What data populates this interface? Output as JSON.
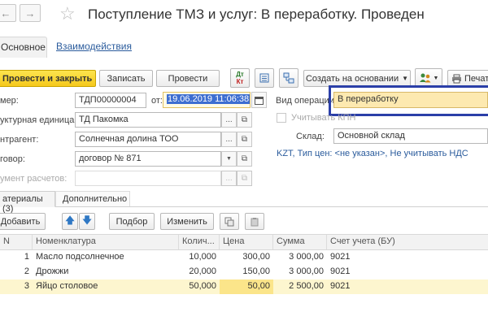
{
  "header": {
    "title": "Поступление ТМЗ и услуг: В переработку. Проведен"
  },
  "tabs": {
    "main": "Основное",
    "related": "Взаимодействия"
  },
  "toolbar": {
    "post_close": "Провести и закрыть",
    "save": "Записать",
    "post": "Провести",
    "create_based": "Создать на основании",
    "print": "Печать",
    "dtkt_line1": "Дт",
    "dtkt_line2": "Кт"
  },
  "form": {
    "number_label": "мер:",
    "number_value": "ТДП00000004",
    "from_label": "от:",
    "date_value": "19.06.2019 11:06:38",
    "unit_label": "уктурная единица:",
    "unit_value": "ТД Пакомка",
    "counterparty_label": "нтрагент:",
    "counterparty_value": "Солнечная долина ТОО",
    "contract_label": "говор:",
    "contract_value": "договор № 871",
    "settlement_label": "умент расчетов:",
    "operation_label": "Вид операции:",
    "operation_value": "В переработку",
    "kpn_label": "Учитывать КПН",
    "warehouse_label": "Склад:",
    "warehouse_value": "Основной склад",
    "price_info": "KZT, Тип цен: <не указан>, Не учитывать НДС"
  },
  "subtabs": {
    "materials": "атериалы (3)",
    "additional": "Дополнительно"
  },
  "table_toolbar": {
    "add": "Добавить",
    "pick": "Подбор",
    "change": "Изменить"
  },
  "table": {
    "columns": [
      "N",
      "Номенклатура",
      "Колич...",
      "Цена",
      "Сумма",
      "Счет учета (БУ)"
    ],
    "rows": [
      {
        "n": "1",
        "name": "Масло подсолнечное",
        "qty": "10,000",
        "price": "300,00",
        "sum": "3 000,00",
        "account": "9021"
      },
      {
        "n": "2",
        "name": "Дрожжи",
        "qty": "20,000",
        "price": "150,00",
        "sum": "3 000,00",
        "account": "9021"
      },
      {
        "n": "3",
        "name": "Яйцо столовое",
        "qty": "50,000",
        "price": "50,00",
        "sum": "2 500,00",
        "account": "9021"
      }
    ]
  },
  "colors": {
    "accent_yellow": "#f5c91c",
    "selection_blue": "#3d6ed1",
    "highlight_frame": "#2b3fa8",
    "row_highlight": "#fdf6cf",
    "link": "#2a5b9c"
  }
}
